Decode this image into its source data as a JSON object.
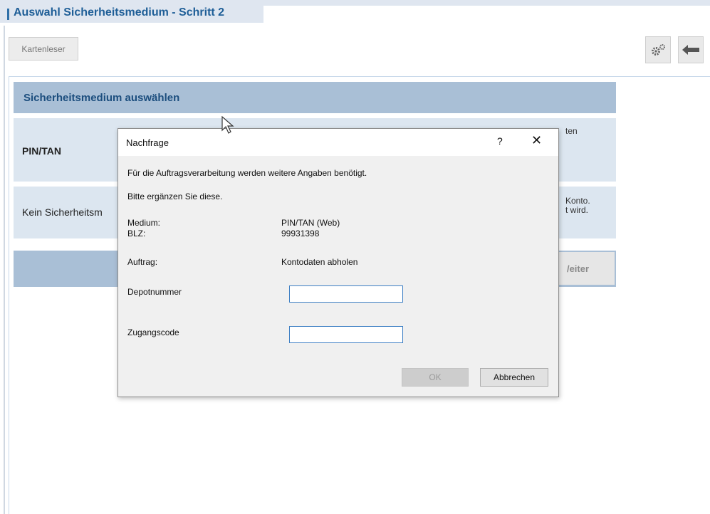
{
  "header": {
    "title": "Auswahl Sicherheitsmedium - Schritt 2"
  },
  "toolbar": {
    "kartenleser_label": "Kartenleser",
    "settings_icon": "gears-icon",
    "back_icon": "arrow-left-icon"
  },
  "panel": {
    "header": "Sicherheitsmedium auswählen",
    "options": [
      {
        "title": "PIN/TAN",
        "right_text": "ten"
      },
      {
        "title": "Kein Sicherheitsm",
        "right_text_line1": "Konto.",
        "right_text_line2": "t wird."
      }
    ],
    "next_label": "Weiter",
    "next_visible_label": "/eiter"
  },
  "dialog": {
    "title": "Nachfrage",
    "help": "?",
    "close": "✕",
    "message1": "Für die Auftragsverarbeitung werden weitere Angaben benötigt.",
    "message2": "Bitte ergänzen Sie diese.",
    "medium_label": "Medium:",
    "medium_value": "PIN/TAN (Web)",
    "blz_label": "BLZ:",
    "blz_value": "99931398",
    "auftrag_label": "Auftrag:",
    "auftrag_value": "Kontodaten abholen",
    "depot_label": "Depotnummer",
    "depot_value": "",
    "zugang_label": "Zugangscode",
    "zugang_value": "",
    "ok_label": "OK",
    "cancel_label": "Abbrechen"
  },
  "colors": {
    "accent": "#1e5e97",
    "panel_header": "#a9bfd6",
    "option_bg": "#dce6f0",
    "input_border": "#3d7fc4"
  }
}
